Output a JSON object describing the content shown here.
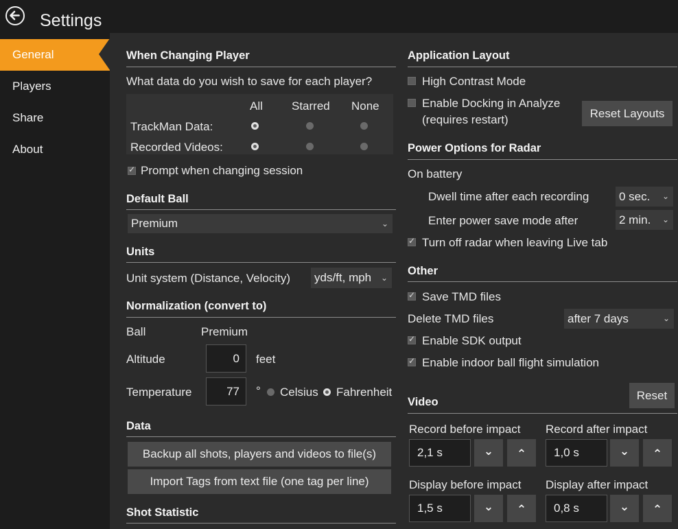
{
  "header": {
    "title": "Settings",
    "back_icon": "back-arrow-icon"
  },
  "sidebar": {
    "items": [
      {
        "label": "General",
        "active": true
      },
      {
        "label": "Players",
        "active": false
      },
      {
        "label": "Share",
        "active": false
      },
      {
        "label": "About",
        "active": false
      }
    ]
  },
  "accent_color": "#f39a1d",
  "changing_player": {
    "heading": "When Changing Player",
    "question": "What data do you wish to save for each player?",
    "columns": [
      "All",
      "Starred",
      "None"
    ],
    "rows": [
      {
        "label": "TrackMan Data:",
        "selected": "All"
      },
      {
        "label": "Recorded Videos:",
        "selected": "All"
      }
    ],
    "prompt_label": "Prompt when changing session",
    "prompt_checked": true
  },
  "default_ball": {
    "heading": "Default Ball",
    "value": "Premium"
  },
  "units": {
    "heading": "Units",
    "label": "Unit system (Distance, Velocity)",
    "value": "yds/ft, mph"
  },
  "normalization": {
    "heading": "Normalization (convert to)",
    "ball_label": "Ball",
    "ball_value": "Premium",
    "altitude_label": "Altitude",
    "altitude_value": "0",
    "altitude_unit": "feet",
    "temperature_label": "Temperature",
    "temperature_value": "77",
    "degree": "°",
    "celsius_label": "Celsius",
    "fahrenheit_label": "Fahrenheit",
    "temp_unit_selected": "Fahrenheit"
  },
  "data": {
    "heading": "Data",
    "backup_label": "Backup all shots, players and videos to file(s)",
    "import_label": "Import Tags from text file (one tag per line)"
  },
  "shot_statistic": {
    "heading": "Shot Statistic"
  },
  "app_layout": {
    "heading": "Application Layout",
    "high_contrast_label": "High Contrast Mode",
    "high_contrast_checked": false,
    "docking_label_1": "Enable Docking in Analyze",
    "docking_label_2": "(requires restart)",
    "docking_checked": false,
    "reset_layouts_label": "Reset Layouts"
  },
  "power": {
    "heading": "Power Options for Radar",
    "battery_label": "On battery",
    "dwell_label": "Dwell time after each recording",
    "dwell_value": "0 sec.",
    "powersave_label": "Enter power save mode after",
    "powersave_value": "2 min.",
    "turnoff_label": "Turn off radar when leaving Live tab",
    "turnoff_checked": true
  },
  "other": {
    "heading": "Other",
    "save_tmd_label": "Save TMD files",
    "save_tmd_checked": true,
    "delete_tmd_label": "Delete TMD files",
    "delete_tmd_value": "after 7 days",
    "sdk_label": "Enable SDK output",
    "sdk_checked": true,
    "indoor_label": "Enable indoor ball flight simulation",
    "indoor_checked": true,
    "reset_label": "Reset"
  },
  "video": {
    "heading": "Video",
    "record_before_label": "Record before impact",
    "record_before_value": "2,1 s",
    "record_after_label": "Record after impact",
    "record_after_value": "1,0 s",
    "display_before_label": "Display before impact",
    "display_before_value": "1,5 s",
    "display_after_label": "Display after impact",
    "display_after_value": "0,8 s",
    "down_glyph": "⌄",
    "up_glyph": "⌃"
  }
}
